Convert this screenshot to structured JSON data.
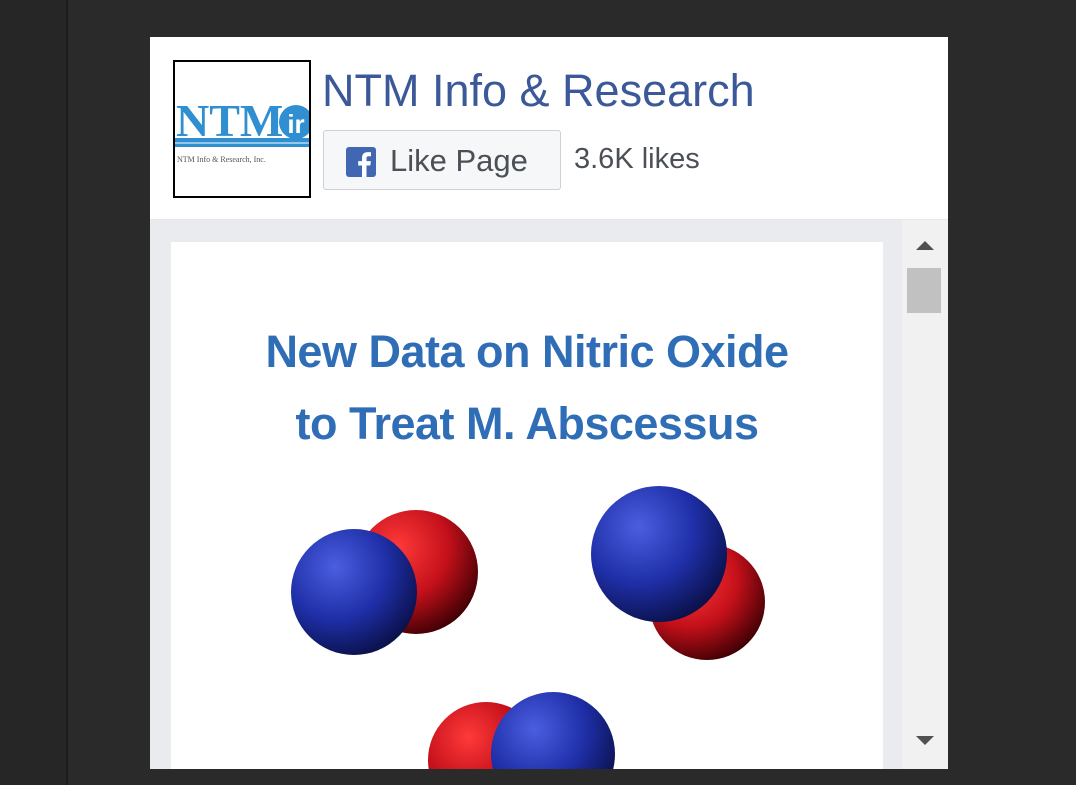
{
  "page": {
    "name": "NTM Info & Research",
    "logo_text": "NTM",
    "logo_badge": "ir",
    "logo_tagline": "NTM Info & Research, Inc.",
    "like_button_label": "Like Page",
    "likes_count": "3.6K likes"
  },
  "post": {
    "headline_line1": "New Data on Nitric Oxide",
    "headline_line2": "to Treat M. Abscessus"
  },
  "icons": {
    "facebook": "facebook-f-icon",
    "scroll_up": "triangle-up-icon",
    "scroll_down": "triangle-down-icon"
  },
  "colors": {
    "page_name": "#3b5998",
    "facebook_blue": "#4267b2",
    "headline": "#2f6eb6",
    "molecule_nitrogen": "#1f2fa8",
    "molecule_oxygen": "#c4101a",
    "outer_background": "#2a2a2a"
  }
}
